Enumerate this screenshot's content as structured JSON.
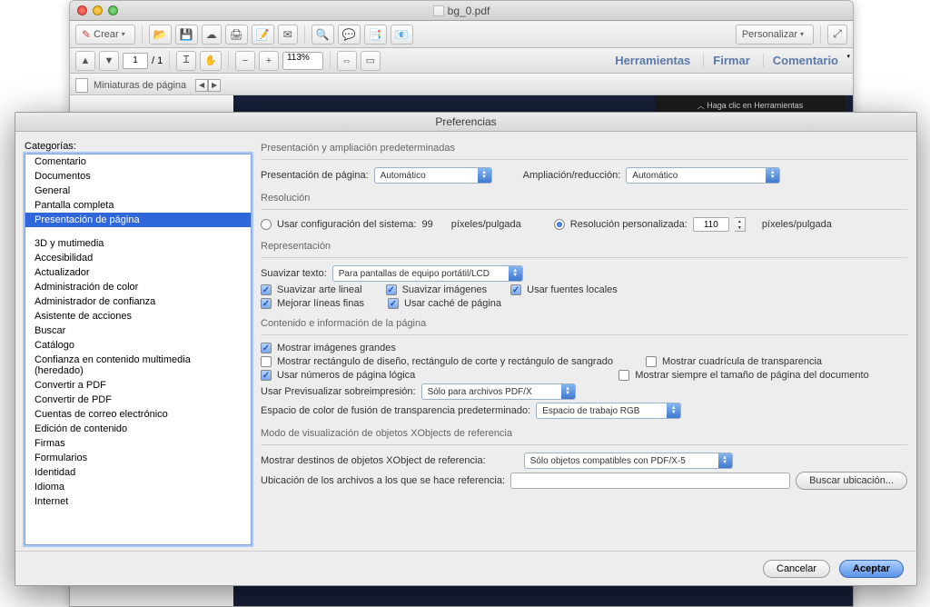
{
  "window": {
    "title": "bg_0.pdf"
  },
  "toolbar": {
    "create": "Crear",
    "personalizar": "Personalizar",
    "herramientas": "Herramientas",
    "firmar": "Firmar",
    "comentario": "Comentario",
    "page_current": "1",
    "page_total": "/ 1",
    "zoom": "113%"
  },
  "sidebar": {
    "thumbs": "Miniaturas de página",
    "hint": "Haga clic en Herramientas"
  },
  "prefs": {
    "title": "Preferencias",
    "cat_label": "Categorías:",
    "categories_top": [
      "Comentario",
      "Documentos",
      "General",
      "Pantalla completa",
      "Presentación de página"
    ],
    "categories_rest": [
      "3D y mutimedia",
      "Accesibilidad",
      "Actualizador",
      "Administración de color",
      "Administrador de confianza",
      "Asistente de acciones",
      "Buscar",
      "Catálogo",
      "Confianza en contenido multimedia (heredado)",
      "Convertir a PDF",
      "Convertir de PDF",
      "Cuentas de correo electrónico",
      "Edición de contenido",
      "Firmas",
      "Formularios",
      "Identidad",
      "Idioma",
      "Internet"
    ],
    "selected_index": 4,
    "g1": {
      "header": "Presentación y ampliación predeterminadas",
      "pres_label": "Presentación de página:",
      "pres_value": "Automático",
      "amp_label": "Ampliación/reducción:",
      "amp_value": "Automático"
    },
    "g2": {
      "header": "Resolución",
      "sys_label": "Usar configuración del sistema:",
      "sys_value": "99",
      "unit": "píxeles/pulgada",
      "custom_label": "Resolución personalizada:",
      "custom_value": "110"
    },
    "g3": {
      "header": "Representación",
      "suavizar_texto_label": "Suavizar texto:",
      "suavizar_texto_value": "Para pantallas de equipo portátil/LCD",
      "c1": "Suavizar arte lineal",
      "c2": "Suavizar imágenes",
      "c3": "Usar fuentes locales",
      "c4": "Mejorar líneas finas",
      "c5": "Usar caché de página"
    },
    "g4": {
      "header": "Contenido e información de la página",
      "c1": "Mostrar imágenes grandes",
      "c2": "Mostrar rectángulo de diseño, rectángulo de corte y rectángulo de sangrado",
      "c2b": "Mostrar cuadrícula de transparencia",
      "c3": "Usar números de página lógica",
      "c3b": "Mostrar siempre el tamaño de página del documento",
      "prev_label": "Usar Previsualizar sobreimpresión:",
      "prev_value": "Sólo para archivos PDF/X",
      "space_label": "Espacio de color de fusión de transparencia predeterminado:",
      "space_value": "Espacio de trabajo RGB"
    },
    "g5": {
      "header": "Modo de visualización de objetos XObjects de referencia",
      "dest_label": "Mostrar destinos de objetos XObject de referencia:",
      "dest_value": "Sólo objetos compatibles con PDF/X-5",
      "loc_label": "Ubicación de los archivos a los que se hace referencia:",
      "browse": "Buscar ubicación..."
    },
    "buttons": {
      "cancel": "Cancelar",
      "ok": "Aceptar"
    }
  }
}
